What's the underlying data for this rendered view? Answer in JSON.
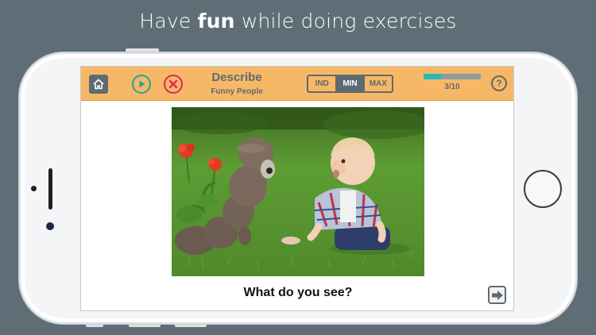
{
  "headline": {
    "prefix": "Have ",
    "emphasis": "fun",
    "suffix": " while doing exercises"
  },
  "toolbar": {
    "home_icon": "home-icon",
    "play_icon": "play-icon",
    "close_icon": "close-icon",
    "title": "Describe",
    "subtitle": "Funny People",
    "levels": [
      {
        "label": "IND",
        "active": false
      },
      {
        "label": "MIN",
        "active": true
      },
      {
        "label": "MAX",
        "active": false
      }
    ],
    "progress": {
      "current": 3,
      "total": 10,
      "label": "3/10"
    },
    "help_label": "?"
  },
  "main": {
    "question": "What do you see?",
    "next_icon": "arrow-right-icon"
  },
  "colors": {
    "background": "#5f6e76",
    "toolbar": "#f6b866",
    "accent_teal": "#2aa09b",
    "accent_red": "#e0245a",
    "text_slate": "#5e6a70",
    "progress_fill": "#2ab8bd"
  }
}
